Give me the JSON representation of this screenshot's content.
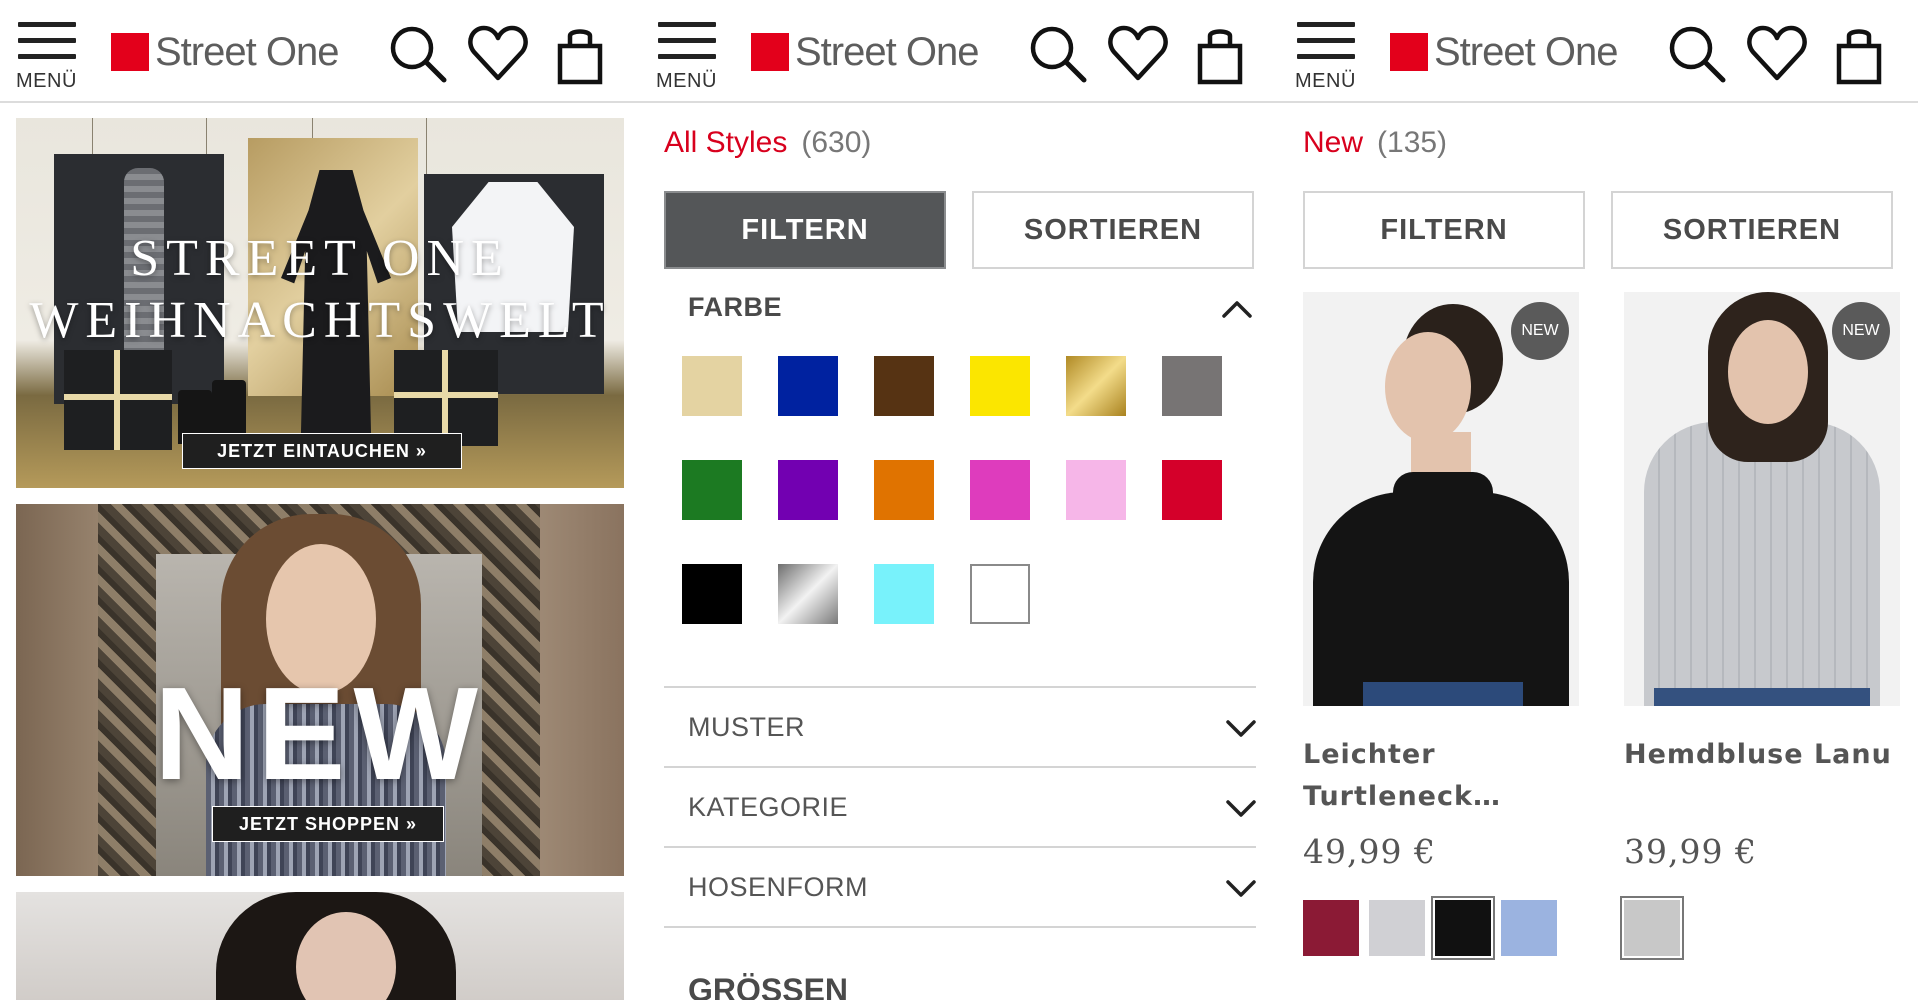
{
  "header": {
    "menu_label": "MENÜ",
    "logo_text": "Street One",
    "brand_color": "#e3001b",
    "icons": [
      "search-icon",
      "heart-icon",
      "shopping-bag-icon"
    ]
  },
  "panel1": {
    "banners": [
      {
        "title_line1": "STREET ONE",
        "title_line2": "WEIHNACHTSWELT",
        "cta": "JETZT EINTAUCHEN »"
      },
      {
        "title": "NEW",
        "cta": "JETZT SHOPPEN »"
      }
    ]
  },
  "panel2": {
    "category": "All Styles",
    "count": "(630)",
    "filter_label": "FILTERN",
    "sort_label": "SORTIEREN",
    "facet_open": "FARBE",
    "colors": [
      "#e4d3a2",
      "#0022a0",
      "#563313",
      "#fbe600",
      "#d7b13f",
      "#777474",
      "#1c7a22",
      "#7200b1",
      "#e07300",
      "#de3cbd",
      "#f6b6e8",
      "#d4002a",
      "#000000",
      "#c0c0c0",
      "#78f2fb",
      "#ffffff"
    ],
    "facets": [
      "MUSTER",
      "KATEGORIE",
      "HOSENFORM"
    ],
    "next_section": "GRÖSSEN"
  },
  "panel3": {
    "category": "New",
    "count": "(135)",
    "filter_label": "FILTERN",
    "sort_label": "SORTIEREN",
    "products": [
      {
        "badge": "NEW",
        "name": "Leichter Turtleneck…",
        "price": "49,99 €",
        "colors": [
          "#8b1a35",
          "#d0d0d4",
          "#111111",
          "#9bb3e0"
        ],
        "selected_color_index": 2
      },
      {
        "badge": "NEW",
        "name": "Hemdbluse Lanu",
        "price": "39,99 €",
        "colors": [
          "#c8c8c8"
        ],
        "selected_color_index": 0
      }
    ]
  }
}
